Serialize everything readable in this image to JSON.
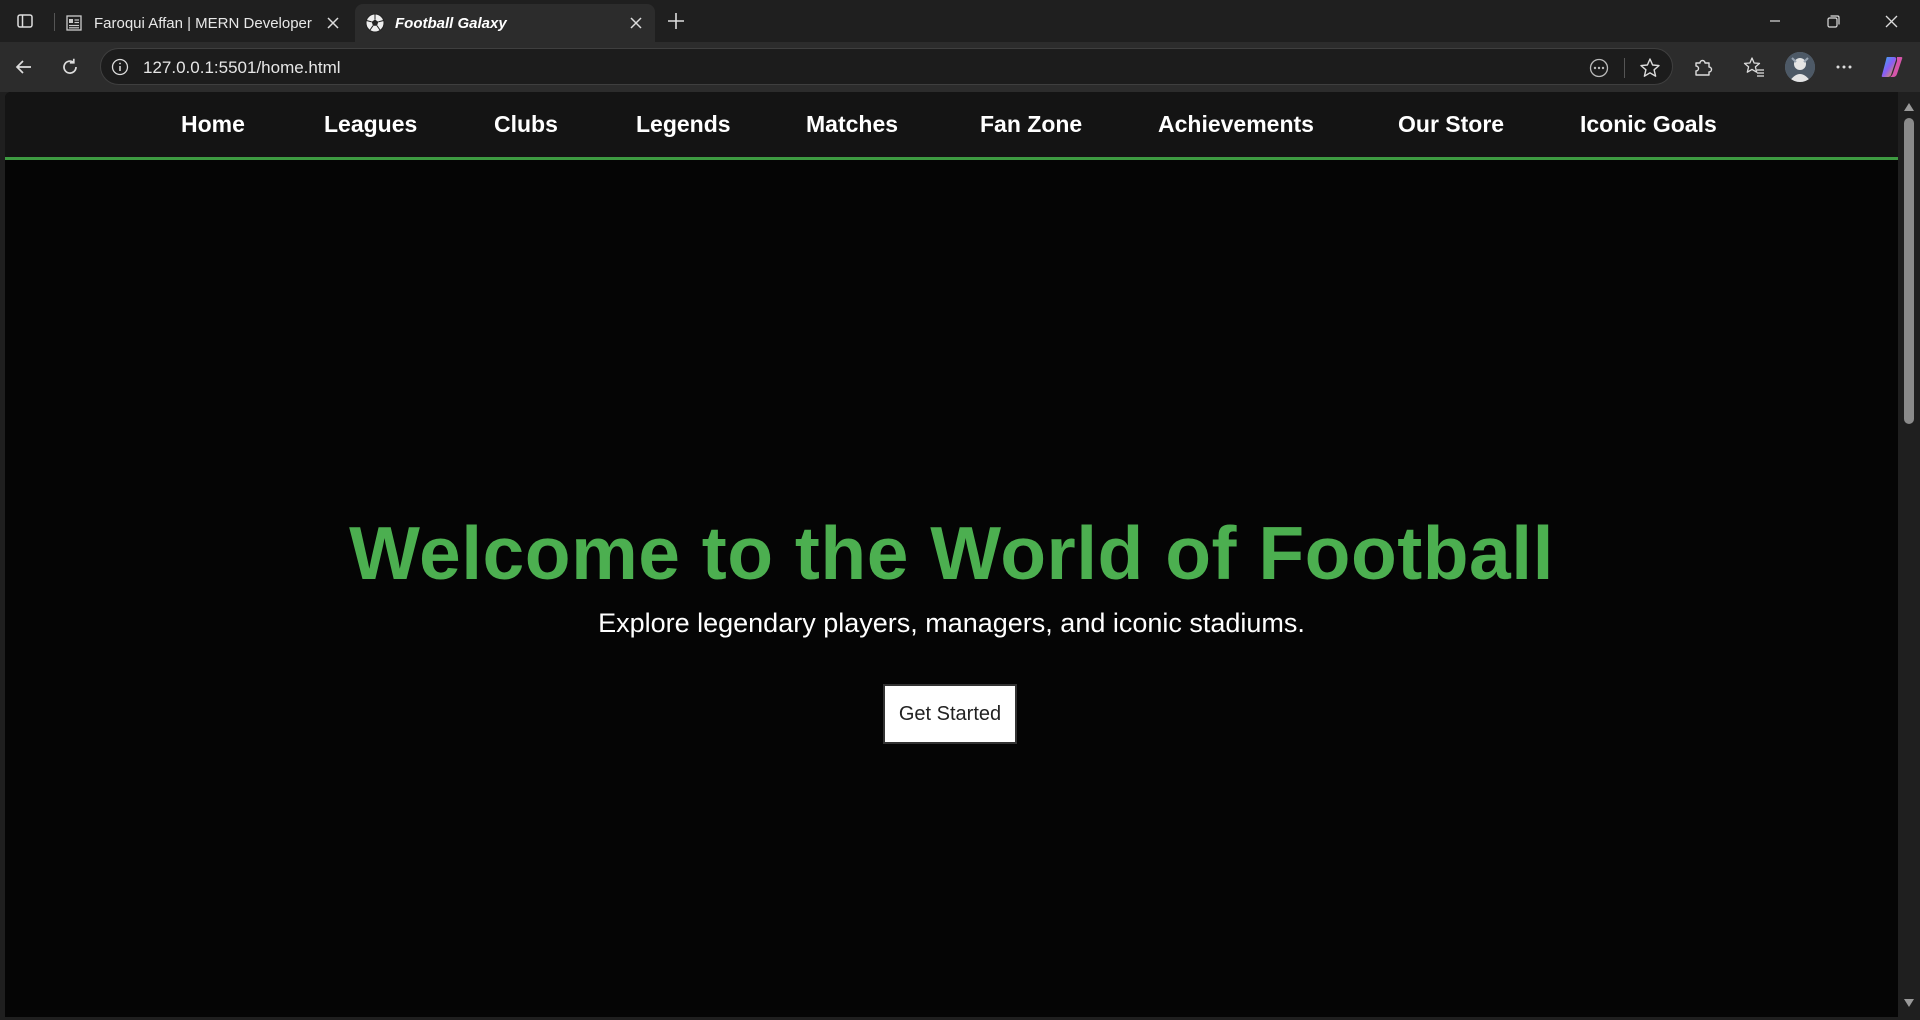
{
  "browser": {
    "tabs": [
      {
        "title": "Faroqui Affan | MERN Developer",
        "favicon": "document-icon",
        "active": false
      },
      {
        "title": "Football Galaxy",
        "favicon": "soccer-ball-icon",
        "active": true
      }
    ],
    "address_bar": {
      "url": "127.0.0.1:5501/home.html"
    }
  },
  "site": {
    "nav": [
      "Home",
      "Leagues",
      "Clubs",
      "Legends",
      "Matches",
      "Fan Zone",
      "Achievements",
      "Our Store",
      "Iconic Goals"
    ],
    "hero": {
      "title": "Welcome to the World of Football",
      "subtitle": "Explore legendary players, managers, and iconic stadiums.",
      "cta": "Get Started"
    }
  },
  "colors": {
    "accent_green": "#4caf50",
    "nav_border": "#3d9a41",
    "page_background": "#050505"
  }
}
